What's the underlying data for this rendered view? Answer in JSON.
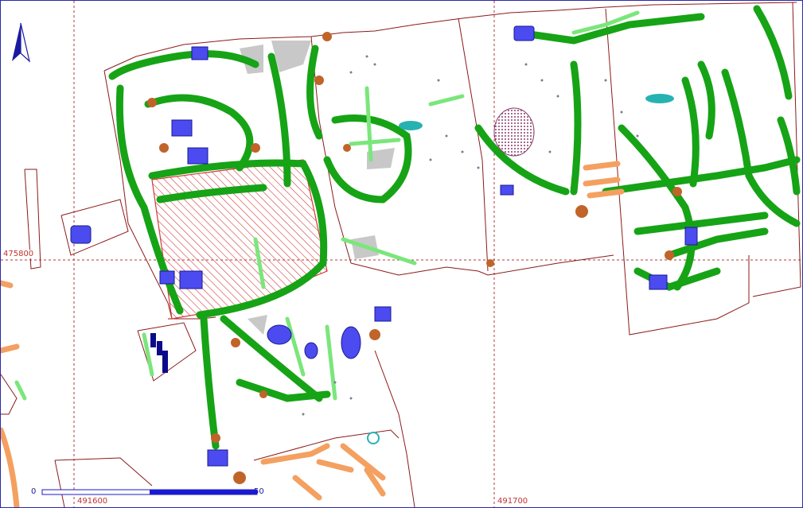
{
  "map": {
    "grid": {
      "easting_labels": [
        "491600",
        "491700"
      ],
      "northing_labels": [
        "475800"
      ],
      "color": "#b33a3a"
    },
    "scale_bar": {
      "start_label": "0",
      "end_label": "50",
      "color": "#1a1ad0"
    },
    "north_arrow": {
      "icon": "north-arrow-icon",
      "color": "#1a1aa0"
    },
    "colors": {
      "parcel_outline": "#8b1a1a",
      "trench_green": "#16a316",
      "light_green": "#7be67b",
      "feature_blue": "#4b4bf0",
      "feature_orange": "#c0642a",
      "feature_salmon": "#f4a060",
      "feature_grey": "#c8c8c8",
      "hatch_red": "#d23a3a",
      "purple_pit": "#8a3a6a",
      "teal": "#27b2b2"
    }
  }
}
